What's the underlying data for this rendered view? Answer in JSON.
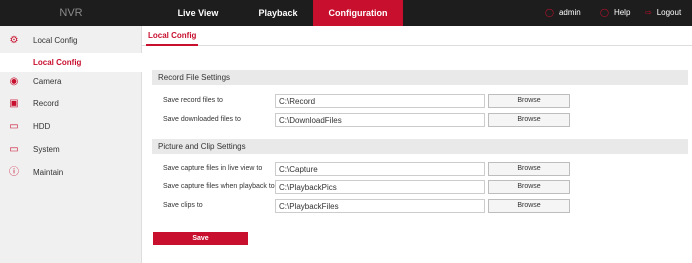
{
  "header": {
    "brand": "NVR",
    "nav": [
      {
        "label": "Live View"
      },
      {
        "label": "Playback"
      },
      {
        "label": "Configuration",
        "active": true
      }
    ],
    "user": "admin",
    "help": "Help",
    "logout": "Logout",
    "accent_color": "#c8102e"
  },
  "sidebar": {
    "items": [
      {
        "label": "Local Config",
        "icon": "gear-icon"
      },
      {
        "label": "Camera",
        "icon": "camera-icon"
      },
      {
        "label": "Record",
        "icon": "record-icon"
      },
      {
        "label": "HDD",
        "icon": "hdd-icon"
      },
      {
        "label": "System",
        "icon": "monitor-icon"
      },
      {
        "label": "Maintain",
        "icon": "info-icon"
      }
    ],
    "sub_item": "Local Config"
  },
  "tab": "Local Config",
  "record_section": {
    "title": "Record File Settings",
    "rows": [
      {
        "label": "Save record files to",
        "value": "C:\\Record",
        "button": "Browse"
      },
      {
        "label": "Save downloaded files to",
        "value": "C:\\DownloadFiles",
        "button": "Browse"
      }
    ]
  },
  "picture_section": {
    "title": "Picture and Clip Settings",
    "rows": [
      {
        "label": "Save capture files in live view to",
        "value": "C:\\Capture",
        "button": "Browse"
      },
      {
        "label": "Save capture files when playback to",
        "value": "C:\\PlaybackPics",
        "button": "Browse"
      },
      {
        "label": "Save clips to",
        "value": "C:\\PlaybackFiles",
        "button": "Browse"
      }
    ]
  },
  "save_label": "Save"
}
